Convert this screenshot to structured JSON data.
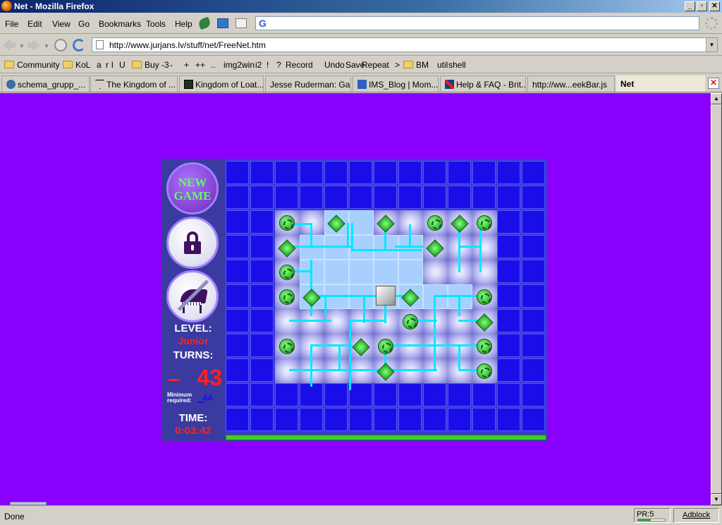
{
  "window": {
    "title": "Net - Mozilla Firefox"
  },
  "menu": {
    "file": "File",
    "edit": "Edit",
    "view": "View",
    "go": "Go",
    "bookmarks": "Bookmarks",
    "tools": "Tools",
    "help": "Help"
  },
  "search": {
    "engine_glyph": "G",
    "value": ""
  },
  "address": {
    "url": "http://www.jurjans.lv/stuff/net/FreeNet.htm"
  },
  "bookmarks": [
    {
      "label": "Community",
      "folder": true
    },
    {
      "label": "KoL",
      "folder": true
    },
    {
      "label": "a",
      "folder": false
    },
    {
      "label": "r",
      "folder": false
    },
    {
      "label": "l",
      "folder": false
    },
    {
      "label": "U",
      "folder": false
    },
    {
      "label": "Buy",
      "folder": true
    },
    {
      "label": "-3",
      "folder": false
    },
    {
      "label": "-",
      "folder": false
    },
    {
      "label": "+",
      "folder": false
    },
    {
      "label": "++",
      "folder": false
    },
    {
      "label": "..",
      "folder": false
    },
    {
      "label": "img2win",
      "folder": false
    },
    {
      "label": "i2",
      "folder": false
    },
    {
      "label": "!",
      "folder": false
    },
    {
      "label": "?",
      "folder": false
    },
    {
      "label": "Record",
      "folder": false
    },
    {
      "label": "Undo",
      "folder": false
    },
    {
      "label": "Save",
      "folder": false
    },
    {
      "label": "Repeat",
      "folder": false
    },
    {
      "label": ">",
      "folder": false
    },
    {
      "label": "BM",
      "folder": true
    },
    {
      "label": "util",
      "folder": false
    },
    {
      "label": "shell",
      "folder": false
    }
  ],
  "tabs": [
    {
      "label": "schema_grupp_...",
      "icon": "globe-icon"
    },
    {
      "label": "The Kingdom of ...",
      "icon": "martini-icon"
    },
    {
      "label": "Kingdom of Loat...",
      "icon": "kol-icon"
    },
    {
      "label": "Jesse Ruderman: Ga...",
      "icon": ""
    },
    {
      "label": "IMS_Blog | Mom...",
      "icon": "ims-icon"
    },
    {
      "label": "Help & FAQ - Brit...",
      "icon": "uk-flag-icon"
    },
    {
      "label": "http://ww...eekBar.js",
      "icon": ""
    },
    {
      "label": "Net",
      "icon": ""
    }
  ],
  "game": {
    "new_game_line1": "NEW",
    "new_game_line2": "GAME",
    "level_label": "LEVEL:",
    "level_value": "Junior",
    "turns_label": "TURNS:",
    "turns_value": "43",
    "min_label_line1": "Minimum",
    "min_label_line2": "required:",
    "min_value": "44",
    "time_label": "TIME:",
    "time_value": "0:03:42",
    "progress_fraction": 1.0
  },
  "status": {
    "text": "Done",
    "pr_label": "PR:5",
    "adblock": "Adblock"
  },
  "colors": {
    "page_bg": "#8a00ff",
    "grid_blue": "#1a0ee8",
    "pipe": "#00e8ff",
    "level_red": "#ff2020"
  }
}
